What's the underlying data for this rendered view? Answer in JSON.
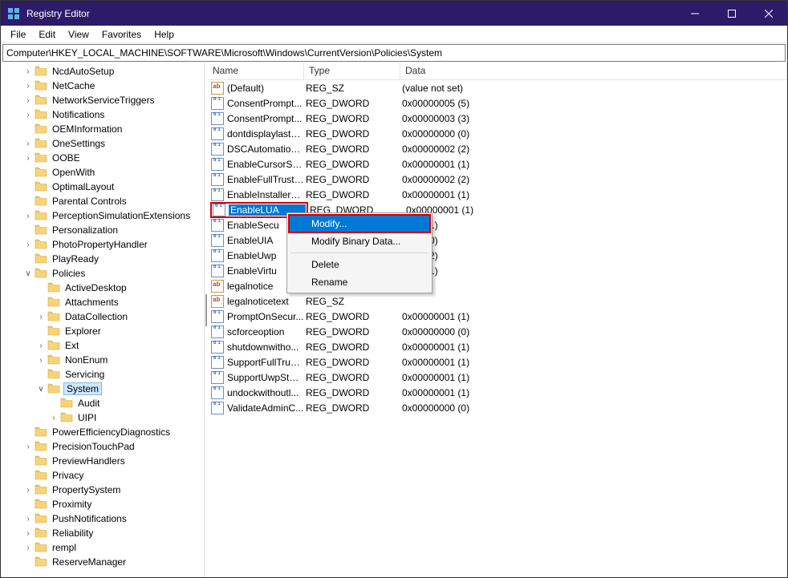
{
  "titlebar": {
    "title": "Registry Editor"
  },
  "menu": {
    "file": "File",
    "edit": "Edit",
    "view": "View",
    "favorites": "Favorites",
    "help": "Help"
  },
  "address": "Computer\\HKEY_LOCAL_MACHINE\\SOFTWARE\\Microsoft\\Windows\\CurrentVersion\\Policies\\System",
  "columns": {
    "name": "Name",
    "type": "Type",
    "data": "Data"
  },
  "tree": [
    {
      "label": "NcdAutoSetup",
      "indent": 1,
      "twist": ">"
    },
    {
      "label": "NetCache",
      "indent": 1,
      "twist": ">"
    },
    {
      "label": "NetworkServiceTriggers",
      "indent": 1,
      "twist": ">"
    },
    {
      "label": "Notifications",
      "indent": 1,
      "twist": ">"
    },
    {
      "label": "OEMInformation",
      "indent": 1,
      "twist": ""
    },
    {
      "label": "OneSettings",
      "indent": 1,
      "twist": ">"
    },
    {
      "label": "OOBE",
      "indent": 1,
      "twist": ">"
    },
    {
      "label": "OpenWith",
      "indent": 1,
      "twist": ""
    },
    {
      "label": "OptimalLayout",
      "indent": 1,
      "twist": ""
    },
    {
      "label": "Parental Controls",
      "indent": 1,
      "twist": ""
    },
    {
      "label": "PerceptionSimulationExtensions",
      "indent": 1,
      "twist": ">"
    },
    {
      "label": "Personalization",
      "indent": 1,
      "twist": ""
    },
    {
      "label": "PhotoPropertyHandler",
      "indent": 1,
      "twist": ">"
    },
    {
      "label": "PlayReady",
      "indent": 1,
      "twist": ""
    },
    {
      "label": "Policies",
      "indent": 1,
      "twist": "v"
    },
    {
      "label": "ActiveDesktop",
      "indent": 2,
      "twist": ""
    },
    {
      "label": "Attachments",
      "indent": 2,
      "twist": ""
    },
    {
      "label": "DataCollection",
      "indent": 2,
      "twist": ">"
    },
    {
      "label": "Explorer",
      "indent": 2,
      "twist": ""
    },
    {
      "label": "Ext",
      "indent": 2,
      "twist": ">"
    },
    {
      "label": "NonEnum",
      "indent": 2,
      "twist": ">"
    },
    {
      "label": "Servicing",
      "indent": 2,
      "twist": ""
    },
    {
      "label": "System",
      "indent": 2,
      "twist": "v",
      "sel": true
    },
    {
      "label": "Audit",
      "indent": 3,
      "twist": ""
    },
    {
      "label": "UIPI",
      "indent": 3,
      "twist": ">"
    },
    {
      "label": "PowerEfficiencyDiagnostics",
      "indent": 1,
      "twist": ""
    },
    {
      "label": "PrecisionTouchPad",
      "indent": 1,
      "twist": ">"
    },
    {
      "label": "PreviewHandlers",
      "indent": 1,
      "twist": ""
    },
    {
      "label": "Privacy",
      "indent": 1,
      "twist": ""
    },
    {
      "label": "PropertySystem",
      "indent": 1,
      "twist": ">"
    },
    {
      "label": "Proximity",
      "indent": 1,
      "twist": ""
    },
    {
      "label": "PushNotifications",
      "indent": 1,
      "twist": ">"
    },
    {
      "label": "Reliability",
      "indent": 1,
      "twist": ">"
    },
    {
      "label": "rempl",
      "indent": 1,
      "twist": ">"
    },
    {
      "label": "ReserveManager",
      "indent": 1,
      "twist": ""
    }
  ],
  "rows": [
    {
      "icon": "sz",
      "name": "(Default)",
      "type": "REG_SZ",
      "data": "(value not set)"
    },
    {
      "icon": "dw",
      "name": "ConsentPrompt...",
      "type": "REG_DWORD",
      "data": "0x00000005 (5)"
    },
    {
      "icon": "dw",
      "name": "ConsentPrompt...",
      "type": "REG_DWORD",
      "data": "0x00000003 (3)"
    },
    {
      "icon": "dw",
      "name": "dontdisplaylastu...",
      "type": "REG_DWORD",
      "data": "0x00000000 (0)"
    },
    {
      "icon": "dw",
      "name": "DSCAutomation...",
      "type": "REG_DWORD",
      "data": "0x00000002 (2)"
    },
    {
      "icon": "dw",
      "name": "EnableCursorSu...",
      "type": "REG_DWORD",
      "data": "0x00000001 (1)"
    },
    {
      "icon": "dw",
      "name": "EnableFullTrustS...",
      "type": "REG_DWORD",
      "data": "0x00000002 (2)"
    },
    {
      "icon": "dw",
      "name": "EnableInstallerD...",
      "type": "REG_DWORD",
      "data": "0x00000001 (1)"
    },
    {
      "icon": "dw",
      "name": "EnableLUA",
      "type": "REG_DWORD",
      "data": "0x00000001 (1)",
      "sel": true,
      "hl": true
    },
    {
      "icon": "dw",
      "name": "EnableSecu",
      "type": "",
      "data": "0001 (1)"
    },
    {
      "icon": "dw",
      "name": "EnableUIA",
      "type": "",
      "data": "0000 (0)"
    },
    {
      "icon": "dw",
      "name": "EnableUwp",
      "type": "",
      "data": "0002 (2)"
    },
    {
      "icon": "dw",
      "name": "EnableVirtu",
      "type": "",
      "data": "0001 (1)"
    },
    {
      "icon": "sz",
      "name": "legalnotice",
      "type": "",
      "data": ""
    },
    {
      "icon": "sz",
      "name": "legalnoticetext",
      "type": "REG_SZ",
      "data": ""
    },
    {
      "icon": "dw",
      "name": "PromptOnSecur...",
      "type": "REG_DWORD",
      "data": "0x00000001 (1)"
    },
    {
      "icon": "dw",
      "name": "scforceoption",
      "type": "REG_DWORD",
      "data": "0x00000000 (0)"
    },
    {
      "icon": "dw",
      "name": "shutdownwitho...",
      "type": "REG_DWORD",
      "data": "0x00000001 (1)"
    },
    {
      "icon": "dw",
      "name": "SupportFullTrust...",
      "type": "REG_DWORD",
      "data": "0x00000001 (1)"
    },
    {
      "icon": "dw",
      "name": "SupportUwpStar...",
      "type": "REG_DWORD",
      "data": "0x00000001 (1)"
    },
    {
      "icon": "dw",
      "name": "undockwithoutl...",
      "type": "REG_DWORD",
      "data": "0x00000001 (1)"
    },
    {
      "icon": "dw",
      "name": "ValidateAdminC...",
      "type": "REG_DWORD",
      "data": "0x00000000 (0)"
    }
  ],
  "ctx": {
    "modify": "Modify...",
    "modifyBinary": "Modify Binary Data...",
    "delete": "Delete",
    "rename": "Rename"
  }
}
